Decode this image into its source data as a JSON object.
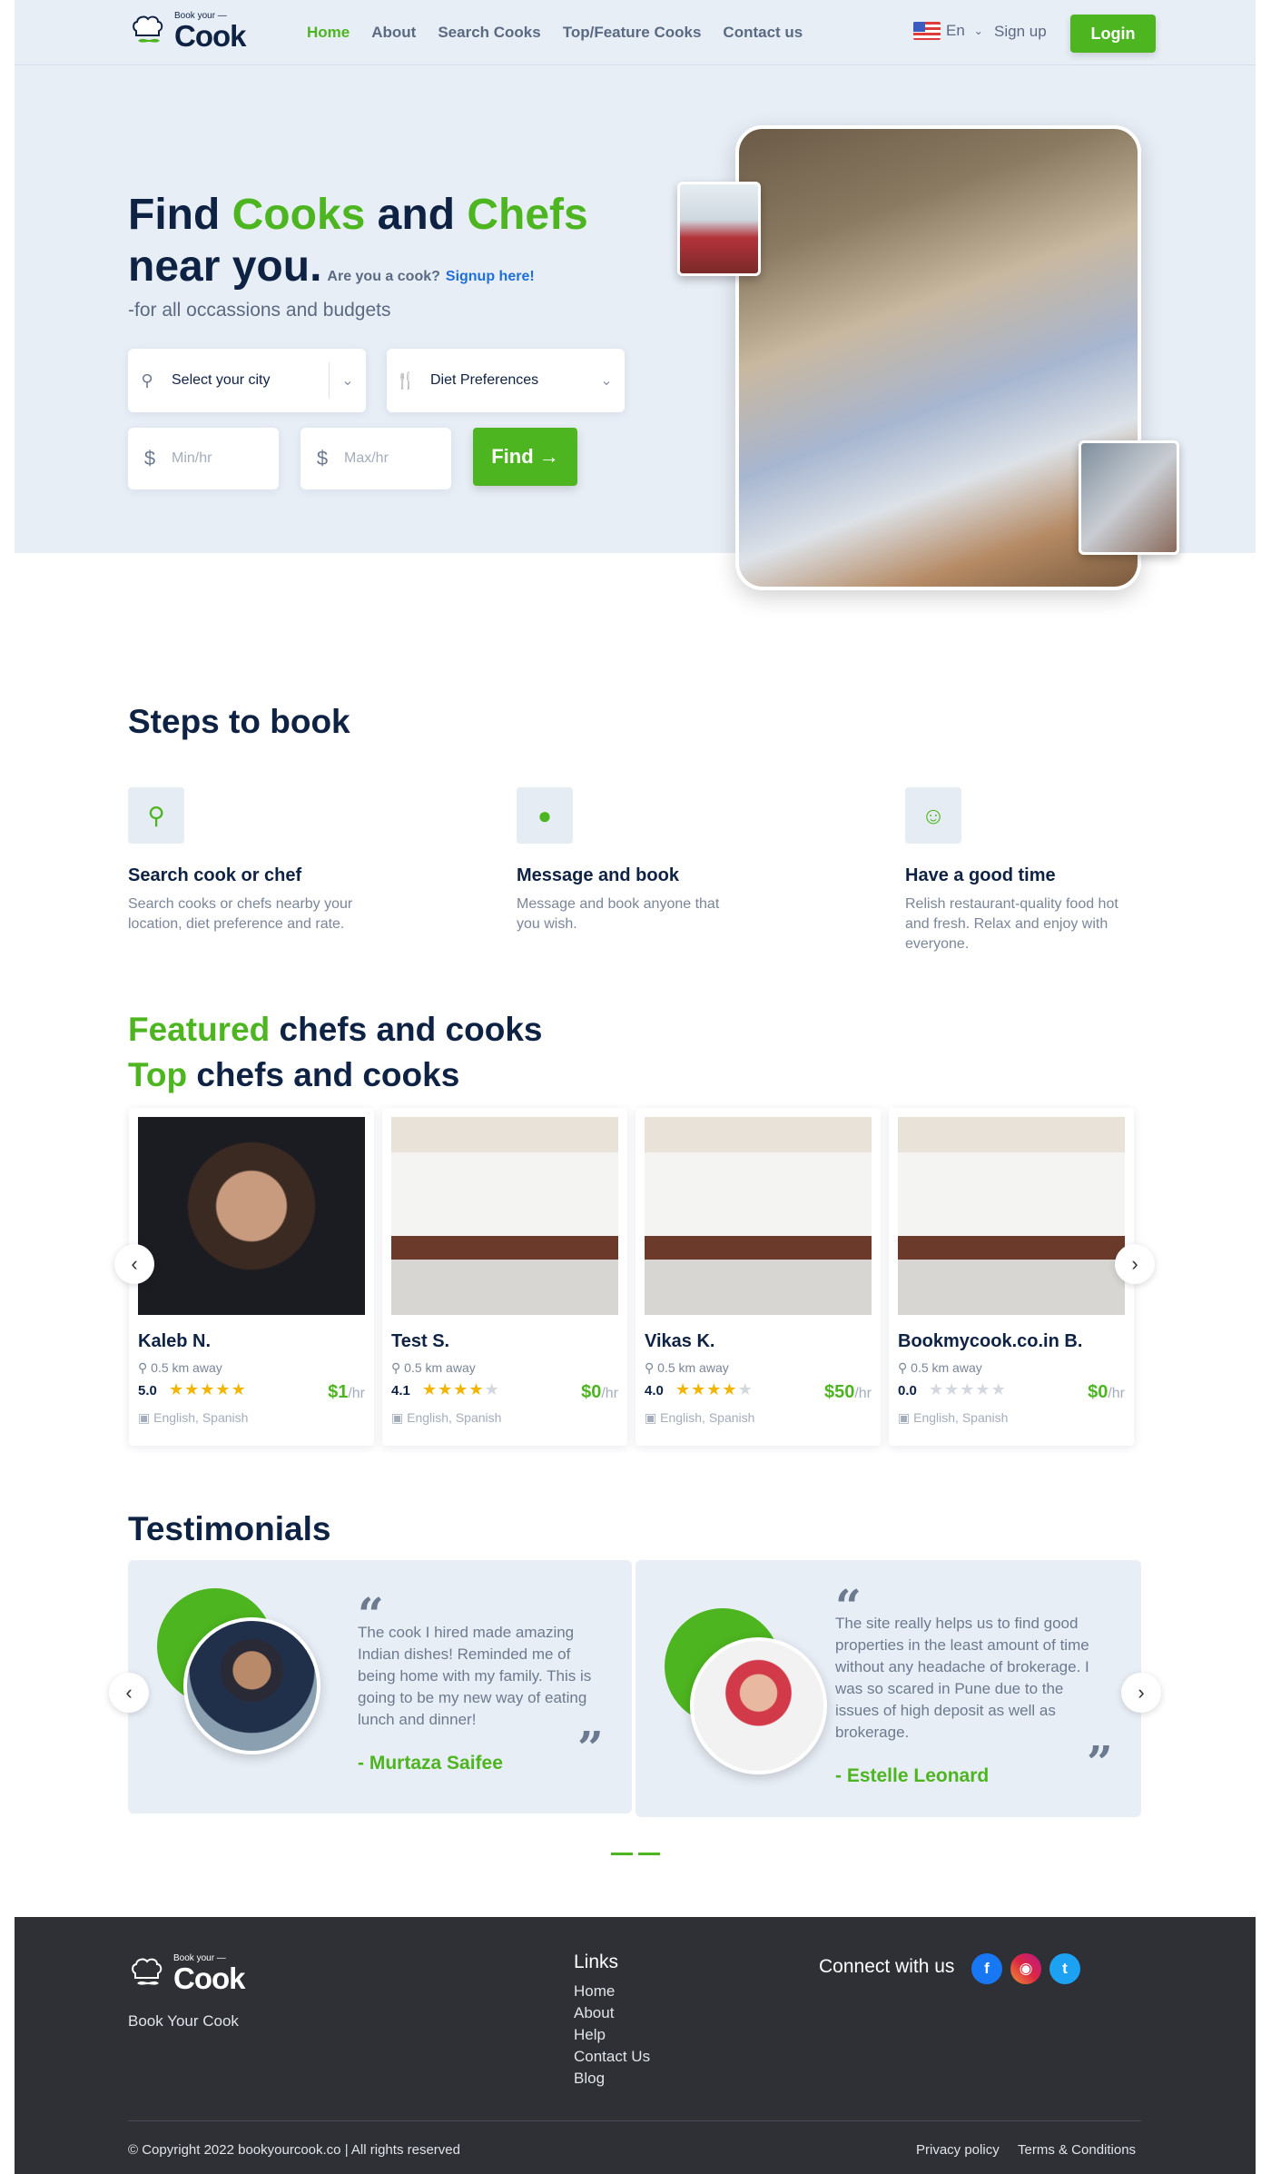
{
  "nav": {
    "logo_small": "Book your —",
    "logo_big": "Cook",
    "links": [
      "Home",
      "About",
      "Search Cooks",
      "Top/Feature Cooks",
      "Contact us"
    ],
    "lang": "En",
    "signup": "Sign up",
    "login": "Login"
  },
  "hero": {
    "title_find": "Find ",
    "title_cooks": "Cooks",
    "title_and": " and ",
    "title_chefs": "Chefs",
    "title_near": "near you.",
    "cook_question": "Are you a cook?",
    "cook_signup": "Signup here!",
    "subtitle": "-for all occassions and budgets",
    "city_placeholder": "Select your city",
    "diet_placeholder": "Diet Preferences",
    "currency": "$",
    "min_placeholder": "Min/hr",
    "max_placeholder": "Max/hr",
    "find_button": "Find →"
  },
  "steps": {
    "title": "Steps to book",
    "items": [
      {
        "icon": "search-icon",
        "title": "Search cook or chef",
        "desc": "Search cooks or chefs nearby your location, diet preference and rate."
      },
      {
        "icon": "chat-icon",
        "title": "Message and book",
        "desc": "Message and book anyone that you wish."
      },
      {
        "icon": "smile-icon",
        "title": "Have a good time",
        "desc": "Relish restaurant-quality food hot and fresh. Relax and enjoy with everyone."
      }
    ]
  },
  "featured": {
    "green": "Featured",
    "rest": " chefs and cooks"
  },
  "top": {
    "green": "Top",
    "rest": " chefs and cooks"
  },
  "cooks": [
    {
      "name": "Kaleb N.",
      "distance": "0.5 km away",
      "rating": "5.0",
      "stars": 5,
      "price": "$1",
      "unit": "/hr",
      "languages": "English, Spanish"
    },
    {
      "name": "Test S.",
      "distance": "0.5 km away",
      "rating": "4.1",
      "stars": 4,
      "price": "$0",
      "unit": "/hr",
      "languages": "English, Spanish"
    },
    {
      "name": "Vikas K.",
      "distance": "0.5 km away",
      "rating": "4.0",
      "stars": 4,
      "price": "$50",
      "unit": "/hr",
      "languages": "English, Spanish"
    },
    {
      "name": "Bookmycook.co.in B.",
      "distance": "0.5 km away",
      "rating": "0.0",
      "stars": 0,
      "price": "$0",
      "unit": "/hr",
      "languages": "English, Spanish"
    }
  ],
  "testimonials": {
    "title": "Testimonials",
    "items": [
      {
        "text": "The cook I hired made amazing Indian dishes! Reminded me of being home with my family. This is going to be my new way of eating lunch and dinner!",
        "name": "- Murtaza Saifee"
      },
      {
        "text": "The site really helps us to find good properties in the least amount of time without any headache of brokerage. I was so scared in Pune due to the issues of high deposit as well as brokerage.",
        "name": "- Estelle Leonard"
      }
    ]
  },
  "footer": {
    "tagline": "Book Your Cook",
    "links_title": "Links",
    "links": [
      "Home",
      "About",
      "Help",
      "Contact Us",
      "Blog"
    ],
    "connect": "Connect with us",
    "copyright": "© Copyright 2022 bookyourcook.co | All rights reserved",
    "privacy": "Privacy policy",
    "terms": "Terms & Conditions"
  },
  "colors": {
    "accent": "#4db51f",
    "navy": "#0e2244",
    "link": "#1e6fd9",
    "footer": "#2e3036"
  }
}
